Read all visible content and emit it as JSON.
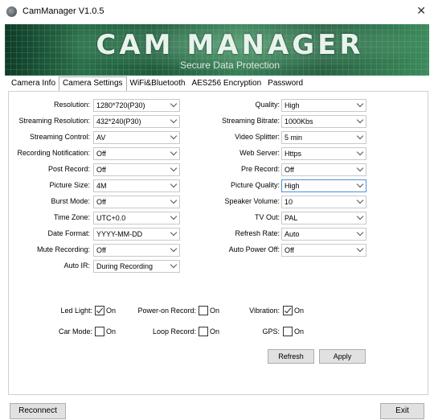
{
  "window": {
    "title": "CamManager V1.0.5",
    "close_glyph": "✕"
  },
  "banner": {
    "title": "CAM MANAGER",
    "subtitle": "Secure Data Protection"
  },
  "tabs": [
    {
      "label": "Camera Info",
      "active": false
    },
    {
      "label": "Camera Settings",
      "active": true
    },
    {
      "label": "WiFi&Bluetooth",
      "active": false
    },
    {
      "label": "AES256 Encryption",
      "active": false
    },
    {
      "label": "Password",
      "active": false
    }
  ],
  "left_settings": [
    {
      "label": "Resolution:",
      "value": "1280*720(P30)"
    },
    {
      "label": "Streaming Resolution:",
      "value": "432*240(P30)"
    },
    {
      "label": "Streaming Control:",
      "value": "AV"
    },
    {
      "label": "Recording Notification:",
      "value": "Off"
    },
    {
      "label": "Post Record:",
      "value": "Off"
    },
    {
      "label": "Picture Size:",
      "value": "4M"
    },
    {
      "label": "Burst Mode:",
      "value": "Off"
    },
    {
      "label": "Time Zone:",
      "value": "UTC+0.0"
    },
    {
      "label": "Date Format:",
      "value": "YYYY-MM-DD"
    },
    {
      "label": "Mute Recording:",
      "value": "Off"
    },
    {
      "label": "Auto IR:",
      "value": "During Recording"
    }
  ],
  "right_settings": [
    {
      "label": "Quality:",
      "value": "High"
    },
    {
      "label": "Streaming Bitrate:",
      "value": "1000Kbs"
    },
    {
      "label": "Video Splitter:",
      "value": "5 min"
    },
    {
      "label": "Web Server:",
      "value": "Https"
    },
    {
      "label": "Pre Record:",
      "value": "Off"
    },
    {
      "label": "Picture Quality:",
      "value": "High"
    },
    {
      "label": "Speaker Volume:",
      "value": "10"
    },
    {
      "label": "TV Out:",
      "value": "PAL"
    },
    {
      "label": "Refresh Rate:",
      "value": "Auto"
    },
    {
      "label": "Auto Power Off:",
      "value": "Off"
    }
  ],
  "checkboxes": [
    {
      "label": "Led Light:",
      "on_label": "On",
      "checked": true
    },
    {
      "label": "Power-on Record:",
      "on_label": "On",
      "checked": false
    },
    {
      "label": "Vibration:",
      "on_label": "On",
      "checked": true
    },
    {
      "label": "Car Mode:",
      "on_label": "On",
      "checked": false
    },
    {
      "label": "Loop Record:",
      "on_label": "On",
      "checked": false
    },
    {
      "label": "GPS:",
      "on_label": "On",
      "checked": false
    }
  ],
  "buttons": {
    "refresh": "Refresh",
    "apply": "Apply",
    "reconnect": "Reconnect",
    "exit": "Exit"
  }
}
